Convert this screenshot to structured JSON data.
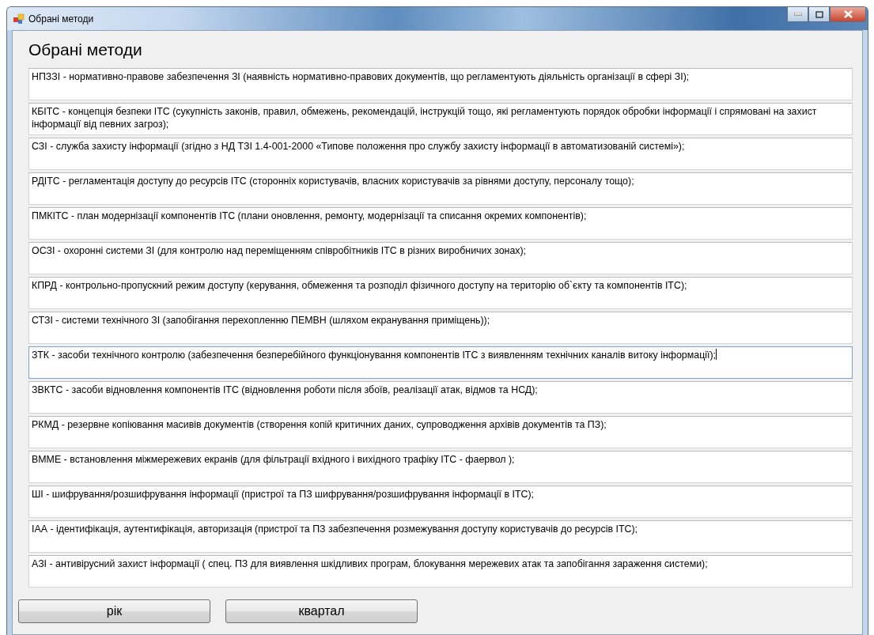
{
  "window": {
    "title": "Обрані методи"
  },
  "heading": "Обрані методи",
  "methods": [
    {
      "text": "НПЗЗІ - нормативно-правове забезпечення ЗІ (наявність нормативно-правових документів, що регламентують діяльність організації в сфері ЗІ);",
      "focused": false
    },
    {
      "text": "КБІТС - концепція безпеки ІТС (сукупність законів, правил, обмежень, рекомендацій, інструкцій тощо, які регламентують порядок обробки інформації і  спрямовані на захист інформації від певних загроз);",
      "focused": false
    },
    {
      "text": "СЗІ - служба захисту інформації (згідно з НД ТЗІ 1.4-001-2000 «Типове положення про службу захисту інформації в автоматизованій системі»);",
      "focused": false
    },
    {
      "text": "РДІТС - регламентація доступу до ресурсів ІТС (сторонніх користувачів, власних користувачів за рівнями доступу, персоналу тощо);",
      "focused": false
    },
    {
      "text": "ПМКІТС - план модернізації компонентів ІТС (плани оновлення, ремонту, модернізації та списання окремих компонентів);",
      "focused": false
    },
    {
      "text": "ОСЗІ - охоронні системи ЗІ (для контролю над переміщенням співробітників ІТС в різних виробничих зонах);",
      "focused": false
    },
    {
      "text": "КПРД - контрольно-пропускний режим доступу (керування, обмеження та розподіл фізичного доступу на територію об`єкту та компонентів ІТС);",
      "focused": false
    },
    {
      "text": "СТЗІ - системи технічного ЗІ (запобігання перехопленню ПЕМВН (шляхом екранування приміщень));",
      "focused": false
    },
    {
      "text": "ЗТК - засоби технічного контролю (забезпечення безперебійного функціонування компонентів ІТС з виявленням технічних каналів витоку інформації);",
      "focused": true
    },
    {
      "text": "ЗВКТС - засоби відновлення компонентів ІТС (відновлення роботи після збоїв, реалізації атак, відмов та НСД);",
      "focused": false
    },
    {
      "text": "РКМД - резервне копіювання масивів документів (створення копій критичних даних, супроводження архівів документів та ПЗ);",
      "focused": false
    },
    {
      "text": "ВММЕ - встановлення міжмережевих екранів (для фільтрації вхідного і вихідного трафіку ІТС - фаервол );",
      "focused": false
    },
    {
      "text": "ШІ - шифрування/розшифрування інформації (пристрої та ПЗ шифрування/розшифрування інформації в ІТС);",
      "focused": false
    },
    {
      "text": "ІАА - ідентифікація, аутентифікація, авторизація (пристрої та ПЗ забезпечення розмежування доступу користувачів до ресурсів ІТС);",
      "focused": false
    },
    {
      "text": "АЗІ - антивірусний захист інформації ( спец. ПЗ для виявлення шкідливих програм, блокування мережевих атак та запобігання зараження системи);",
      "focused": false
    }
  ],
  "buttons": [
    "рік",
    "квартал"
  ]
}
